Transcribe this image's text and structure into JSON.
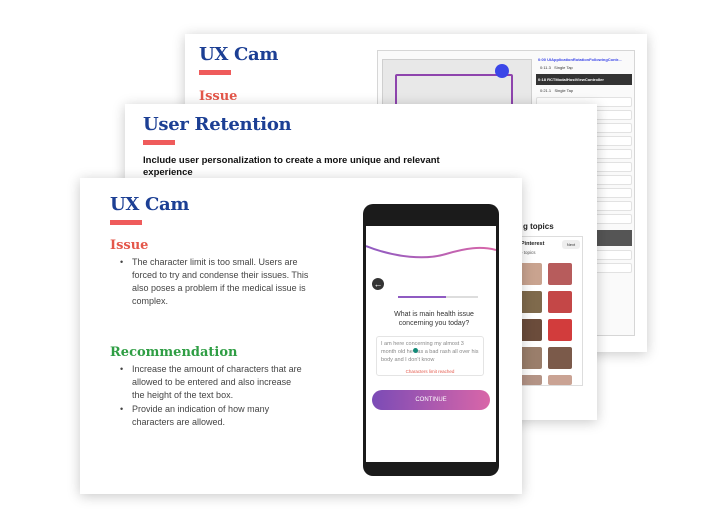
{
  "back_slide": {
    "title": "UX Cam",
    "issue_heading": "Issue",
    "dash_line1": "0:00 UIApplicationRotationFollowingContr...",
    "dash_line2": "0:18 RCTModalHostViewController",
    "chip1": "0:11.3",
    "chip1_label": "Single Tap",
    "chip2": "0:21.1",
    "chip2_label": "Single Tap"
  },
  "mid_slide": {
    "title": "User Retention",
    "subtitle": "Include user personalization to create a more unique and relevant experience",
    "topics_label": "g topics",
    "pinterest_label": "o Pinterest",
    "more_topics": "ore topics",
    "next_btn": "Next"
  },
  "front_slide": {
    "title": "UX Cam",
    "issue_heading": "Issue",
    "issue_text": "The character limit is too small. Users are forced to try and condense their issues. This also poses a problem if the medical issue is complex.",
    "rec_heading": "Recommendation",
    "rec_items": [
      "Increase the amount of characters that are allowed to be entered and also increase the height of the text box.",
      "Provide an indication of how many characters are allowed."
    ],
    "phone": {
      "question": "What is main health issue concerning you today?",
      "input_text": "I am here concerning my almost 3 month old he has a bad rash all over his body and I don't know",
      "limit_text": "Characters limit reached",
      "continue_label": "CONTINUE"
    }
  },
  "colors": {
    "title_blue": "#1c3f94",
    "accent_red": "#ef5b5b",
    "issue_red": "#e4574a",
    "rec_green": "#2f9e44",
    "button_gradient_start": "#7b4bb6",
    "button_gradient_end": "#d966a8"
  }
}
